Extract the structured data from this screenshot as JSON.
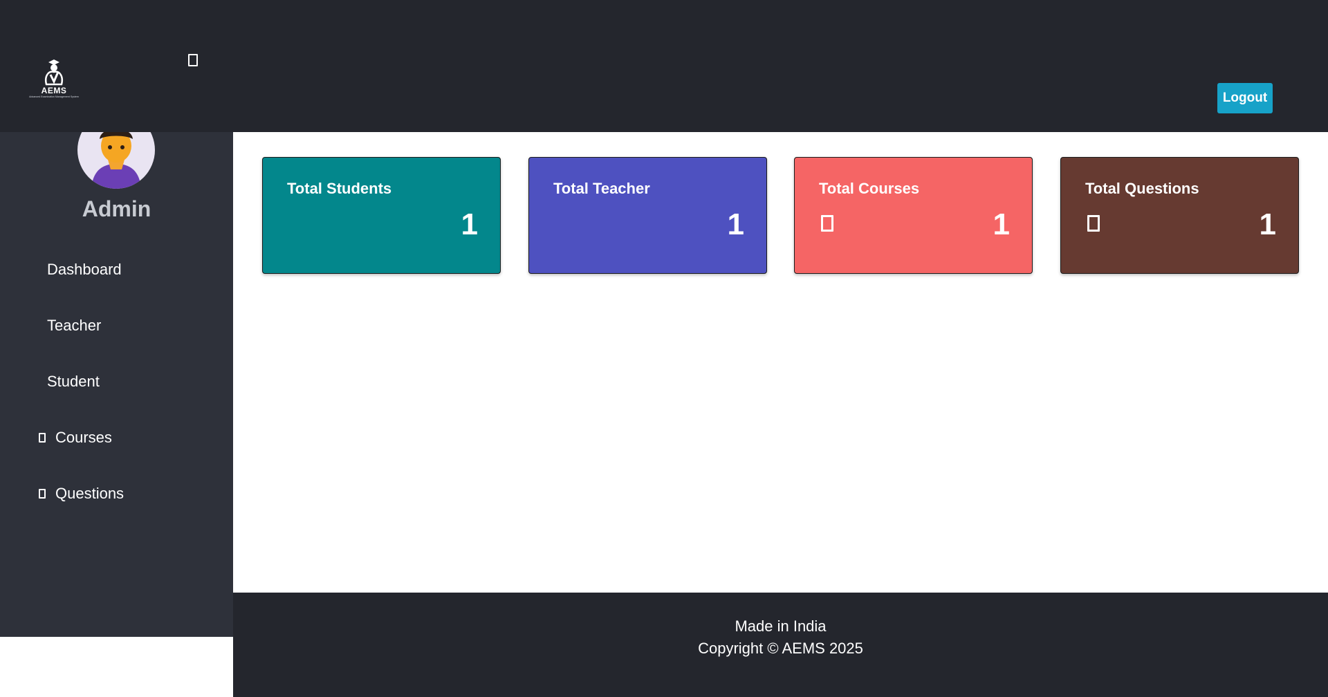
{
  "header": {
    "logo": {
      "name": "AEMS",
      "tagline": "Advanced Examination Management System"
    },
    "menu_toggle_icon": "hamburger-icon",
    "logout_label": "Logout",
    "background": "#24262d",
    "logout_color": "#17a2c8"
  },
  "sidebar": {
    "user_name": "Admin",
    "items": [
      {
        "label": "Dashboard",
        "icon": null
      },
      {
        "label": "Teacher",
        "icon": null
      },
      {
        "label": "Student",
        "icon": null
      },
      {
        "label": "Courses",
        "icon": "book-icon"
      },
      {
        "label": "Questions",
        "icon": "question-icon"
      }
    ],
    "background": "#2e313a"
  },
  "cards": [
    {
      "title": "Total Students",
      "value": "1",
      "icon": null,
      "color": "#03878c"
    },
    {
      "title": "Total Teacher",
      "value": "1",
      "icon": null,
      "color": "#4e51c0"
    },
    {
      "title": "Total Courses",
      "value": "1",
      "icon": "book-icon",
      "color": "#f56565"
    },
    {
      "title": "Total Questions",
      "value": "1",
      "icon": "question-icon",
      "color": "#663a31"
    }
  ],
  "footer": {
    "line1": "Made in India",
    "line2": "Copyright © AEMS 2025"
  }
}
